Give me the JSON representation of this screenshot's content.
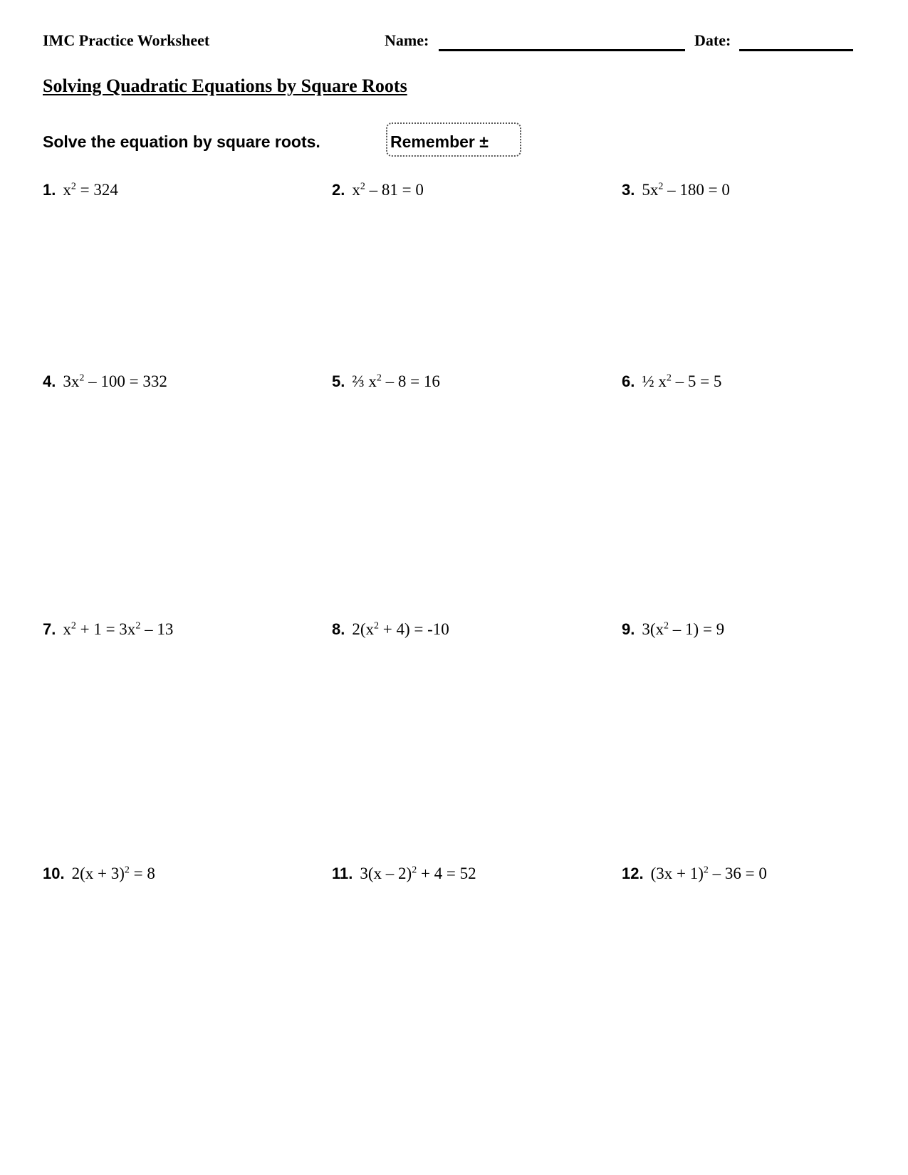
{
  "header": {
    "worksheet_title": "IMC Practice Worksheet",
    "name_label": "Name:",
    "name_value": "",
    "date_label": "Date:",
    "date_value": ""
  },
  "title": "Solving Quadratic Equations by Square Roots",
  "instructions": "Solve the equation by square roots.",
  "reminder": "Remember ±",
  "problems": [
    {
      "number": "1.",
      "equation_html": "x<sup>2</sup> = 324"
    },
    {
      "number": "2.",
      "equation_html": "x<sup>2</sup> – 81 = 0"
    },
    {
      "number": "3.",
      "equation_html": "5x<sup>2</sup> – 180 = 0"
    },
    {
      "number": "4.",
      "equation_html": "3x<sup>2</sup> – 100 = 332"
    },
    {
      "number": "5.",
      "equation_html": "⅔ x<sup>2</sup> – 8 = 16"
    },
    {
      "number": "6.",
      "equation_html": "½ x<sup>2</sup> – 5 = 5"
    },
    {
      "number": "7.",
      "equation_html": "x<sup>2</sup> + 1 = 3x<sup>2</sup> – 13"
    },
    {
      "number": "8.",
      "equation_html": "2(x<sup>2</sup> + 4) = -10"
    },
    {
      "number": "9.",
      "equation_html": "3(x<sup>2</sup> – 1) = 9"
    },
    {
      "number": "10.",
      "equation_html": "2(x + 3)<sup>2</sup> = 8"
    },
    {
      "number": "11.",
      "equation_html": "3(x – 2)<sup>2</sup> + 4 = 52"
    },
    {
      "number": "12.",
      "equation_html": "(3x + 1)<sup>2</sup> – 36 = 0"
    }
  ]
}
